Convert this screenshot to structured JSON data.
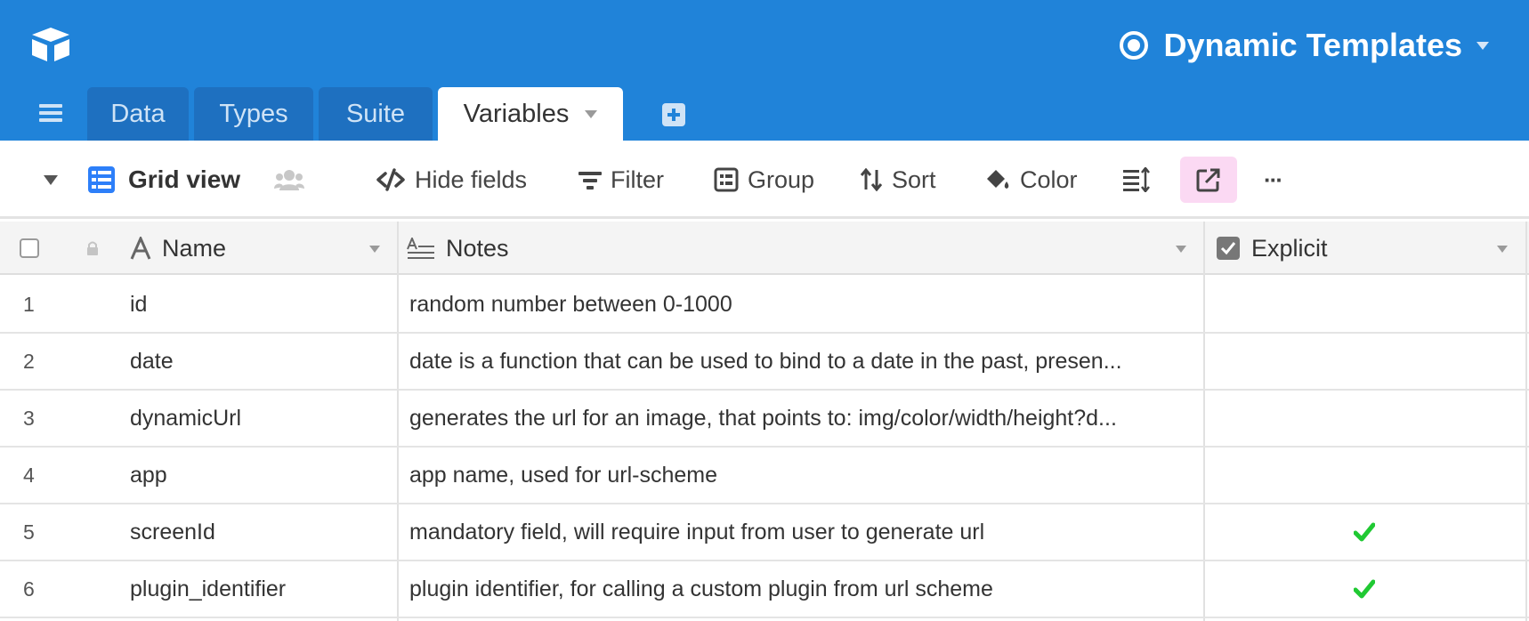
{
  "base": {
    "title": "Dynamic Templates"
  },
  "tabs": [
    {
      "label": "Data",
      "active": false
    },
    {
      "label": "Types",
      "active": false
    },
    {
      "label": "Suite",
      "active": false
    },
    {
      "label": "Variables",
      "active": true
    }
  ],
  "toolbar": {
    "view_name": "Grid view",
    "hide_fields": "Hide fields",
    "filter": "Filter",
    "group": "Group",
    "sort": "Sort",
    "color": "Color",
    "more": "···"
  },
  "columns": {
    "name": "Name",
    "notes": "Notes",
    "explicit": "Explicit"
  },
  "rows": [
    {
      "num": "1",
      "name": "id",
      "notes": "random number between 0-1000",
      "explicit": false
    },
    {
      "num": "2",
      "name": "date",
      "notes": "date is a function that can be used to bind to a date in the past, presen...",
      "explicit": false
    },
    {
      "num": "3",
      "name": "dynamicUrl",
      "notes": "generates the url for an image, that points to: img/color/width/height?d...",
      "explicit": false
    },
    {
      "num": "4",
      "name": "app",
      "notes": "app name, used for url-scheme",
      "explicit": false
    },
    {
      "num": "5",
      "name": "screenId",
      "notes": "mandatory field, will require input from user to generate url",
      "explicit": true
    },
    {
      "num": "6",
      "name": "plugin_identifier",
      "notes": "plugin identifier, for calling a custom plugin from url scheme",
      "explicit": true
    }
  ],
  "colors": {
    "header_blue": "#2083d9",
    "tab_inactive": "#1e70c0",
    "share_highlight": "#fbd9f3",
    "check_green": "#20c933"
  },
  "icons": [
    "logo-icon",
    "base-icon",
    "menu-icon",
    "add-tab-icon",
    "collapse-icon",
    "grid-view-icon",
    "collaborators-icon",
    "hide-fields-icon",
    "filter-icon",
    "group-icon",
    "sort-icon",
    "paint-bucket-icon",
    "row-height-icon",
    "share-icon",
    "more-icon",
    "lock-icon",
    "text-field-icon",
    "long-text-icon",
    "checkbox-field-icon",
    "checkmark-icon"
  ]
}
